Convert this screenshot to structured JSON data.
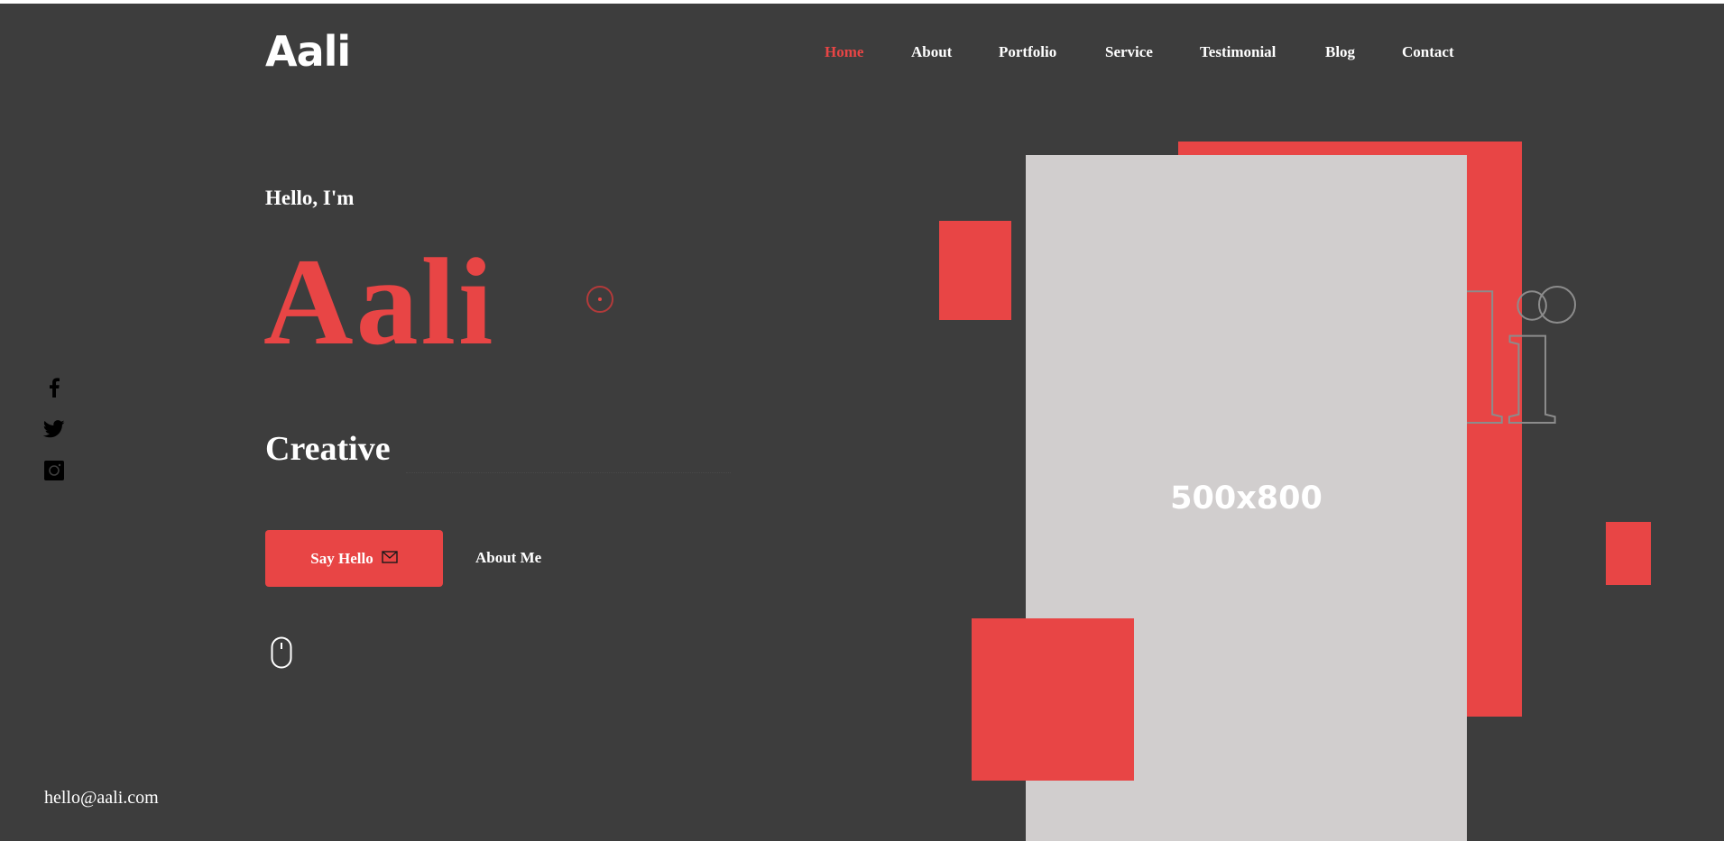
{
  "brand": {
    "logo": "Aali"
  },
  "nav": {
    "items": [
      {
        "label": "Home",
        "active": true
      },
      {
        "label": "About",
        "active": false
      },
      {
        "label": "Portfolio",
        "active": false
      },
      {
        "label": "Service",
        "active": false
      },
      {
        "label": "Testimonial",
        "active": false
      },
      {
        "label": "Blog",
        "active": false
      },
      {
        "label": "Contact",
        "active": false
      }
    ]
  },
  "social": [
    "facebook-icon",
    "twitter-icon",
    "instagram-icon"
  ],
  "hero": {
    "greeting": "Hello, I'm",
    "name": "Aali",
    "role": "Creative",
    "primary_button": "Say Hello",
    "secondary_button": "About Me",
    "outline_name": "li"
  },
  "image": {
    "placeholder": "500x800"
  },
  "contact": {
    "email": "hello@aali.com"
  },
  "colors": {
    "background": "#3d3d3d",
    "accent": "#e84545",
    "placeholder": "#d1cece",
    "text": "#ffffff"
  }
}
